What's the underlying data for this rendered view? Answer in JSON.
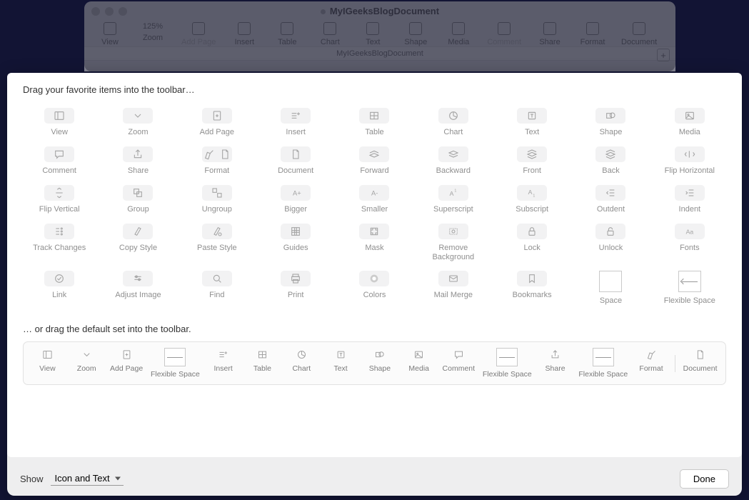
{
  "window": {
    "title": "MyIGeeksBlogDocument",
    "subtitle": "MyIGeeksBlogDocument"
  },
  "toolbar": {
    "view": "View",
    "zoom": "Zoom",
    "zoom_value": "125%",
    "addpage": "Add Page",
    "insert": "Insert",
    "table": "Table",
    "chart": "Chart",
    "text": "Text",
    "shape": "Shape",
    "media": "Media",
    "comment": "Comment",
    "share": "Share",
    "format": "Format",
    "document": "Document"
  },
  "sheet": {
    "prompt": "Drag your favorite items into the toolbar…",
    "prompt2": "… or drag the default set into the toolbar.",
    "items": [
      {
        "l": "View"
      },
      {
        "l": "Zoom"
      },
      {
        "l": "Add Page"
      },
      {
        "l": "Insert"
      },
      {
        "l": "Table"
      },
      {
        "l": "Chart"
      },
      {
        "l": "Text"
      },
      {
        "l": "Shape"
      },
      {
        "l": "Media"
      },
      {
        "l": "Comment"
      },
      {
        "l": "Share"
      },
      {
        "l": "Format"
      },
      {
        "l": "Document"
      },
      {
        "l": "Forward"
      },
      {
        "l": "Backward"
      },
      {
        "l": "Front"
      },
      {
        "l": "Back"
      },
      {
        "l": "Flip Horizontal"
      },
      {
        "l": "Flip Vertical"
      },
      {
        "l": "Group"
      },
      {
        "l": "Ungroup"
      },
      {
        "l": "Bigger"
      },
      {
        "l": "Smaller"
      },
      {
        "l": "Superscript"
      },
      {
        "l": "Subscript"
      },
      {
        "l": "Outdent"
      },
      {
        "l": "Indent"
      },
      {
        "l": "Track Changes"
      },
      {
        "l": "Copy Style"
      },
      {
        "l": "Paste Style"
      },
      {
        "l": "Guides"
      },
      {
        "l": "Mask"
      },
      {
        "l": "Remove\nBackground"
      },
      {
        "l": "Lock"
      },
      {
        "l": "Unlock"
      },
      {
        "l": "Fonts"
      },
      {
        "l": "Link"
      },
      {
        "l": "Adjust Image"
      },
      {
        "l": "Find"
      },
      {
        "l": "Print"
      },
      {
        "l": "Colors"
      },
      {
        "l": "Mail Merge"
      },
      {
        "l": "Bookmarks"
      },
      {
        "l": "Space"
      },
      {
        "l": "Flexible Space"
      }
    ],
    "defaults": [
      {
        "l": "View"
      },
      {
        "l": "Zoom"
      },
      {
        "l": "Add Page"
      },
      {
        "l": "Flexible Space"
      },
      {
        "l": "Insert"
      },
      {
        "l": "Table"
      },
      {
        "l": "Chart"
      },
      {
        "l": "Text"
      },
      {
        "l": "Shape"
      },
      {
        "l": "Media"
      },
      {
        "l": "Comment"
      },
      {
        "l": "Flexible Space"
      },
      {
        "l": "Share"
      },
      {
        "l": "Flexible Space"
      },
      {
        "l": "Format"
      },
      {
        "l": "Document"
      }
    ]
  },
  "bottom": {
    "show": "Show",
    "option": "Icon and Text",
    "done": "Done"
  }
}
